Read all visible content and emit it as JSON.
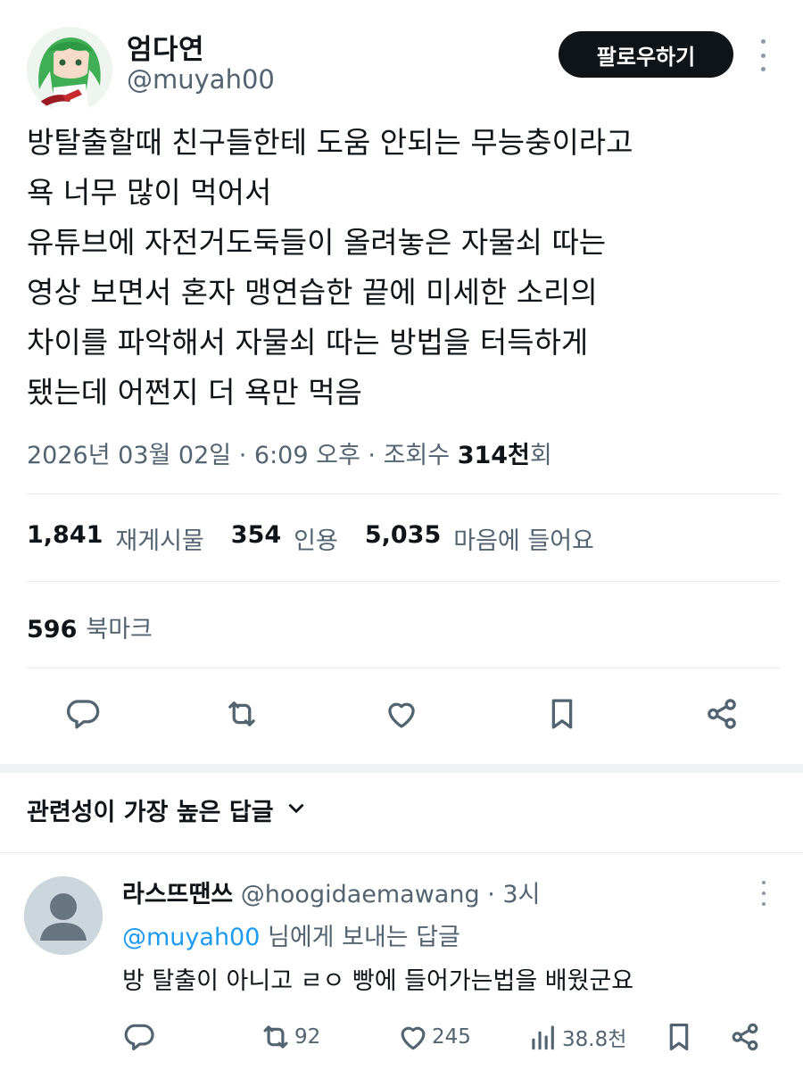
{
  "author": {
    "display_name": "엄다연",
    "handle": "@muyah00",
    "follow_label": "팔로우하기"
  },
  "tweet": {
    "text": "방탈출할때 친구들한테 도움 안되는 무능충이라고\n욕 너무 많이 먹어서\n유튜브에 자전거도둑들이 올려놓은 자물쇠 따는\n영상 보면서 혼자 맹연습한 끝에 미세한 소리의\n차이를 파악해서 자물쇠 따는 방법을 터득하게\n됐는데 어쩐지 더 욕만 먹음",
    "date": "2026년 03월 02일",
    "time": "6:09 오후",
    "views_label": "조회수",
    "views_value": "314천",
    "views_suffix": "회"
  },
  "stats": {
    "retweets": "1,841",
    "retweets_label": "재게시물",
    "quotes": "354",
    "quotes_label": "인용",
    "likes": "5,035",
    "likes_label": "마음에 들어요",
    "bookmarks": "596",
    "bookmarks_label": "북마크"
  },
  "actions": {
    "icons": [
      "reply-icon",
      "retweet-icon",
      "like-icon",
      "bookmark-icon",
      "share-icon"
    ]
  },
  "replies_section": {
    "sort_label": "관련성이 가장 높은 답글"
  },
  "reply": {
    "display_name": "라스뜨땐쓰",
    "handle": "@hoogidaemawang",
    "separator": "·",
    "time": "3시",
    "replying_prefix": "@muyah00",
    "replying_suffix": "님에게 보내는 답글",
    "text": "방 탈출이 아니고 ㄹㅇ 빵에 들어가는법을 배웠군요",
    "retweets": "92",
    "likes": "245",
    "views": "38.8천"
  },
  "colors": {
    "text_primary": "#0f1419",
    "text_secondary": "#536471",
    "accent": "#1d9bf0",
    "follow_bg": "#0f1419"
  }
}
